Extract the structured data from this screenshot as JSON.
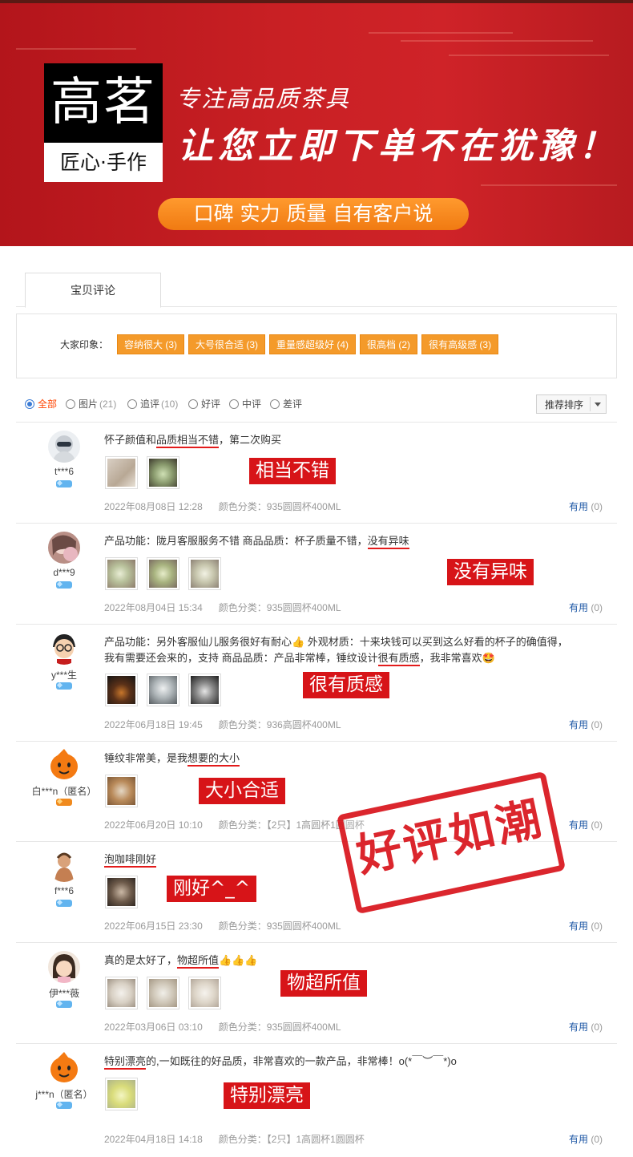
{
  "banner": {
    "logo_big": "高茗",
    "logo_small": "匠心·手作",
    "slogan1": "专注高品质茶具",
    "slogan2": "让您立即下单不在犹豫！",
    "pill": "口碑 实力 质量 自有客户说"
  },
  "tab": {
    "label": "宝贝评论"
  },
  "impressions": {
    "label": "大家印象：",
    "tags": [
      "容纳很大 (3)",
      "大号很合适 (3)",
      "重量感超级好 (4)",
      "很高档 (2)",
      "很有高级感 (3)"
    ]
  },
  "filters": [
    {
      "label": "全部",
      "count": ""
    },
    {
      "label": "图片",
      "count": "(21)"
    },
    {
      "label": "追评",
      "count": "(10)"
    },
    {
      "label": "好评",
      "count": ""
    },
    {
      "label": "中评",
      "count": ""
    },
    {
      "label": "差评",
      "count": ""
    }
  ],
  "sort": {
    "label": "推荐排序"
  },
  "useful_label": "有用",
  "useful_count": "(0)",
  "color_prefix": "颜色分类：",
  "reviews": [
    {
      "user": "t***6",
      "text_pre": "怀子颜值和",
      "text_mark": "品质相当不错",
      "text_post": "，第二次购买",
      "stamp": "相当不错",
      "date": "2022年08月08日 12:28",
      "color": "935圆圆杯400ML"
    },
    {
      "user": "d***9",
      "text_pre": "产品功能：陇月客服服务不错 商品品质：杯子质量不错，",
      "text_mark": "没有异味",
      "text_post": "",
      "stamp": "没有异味",
      "date": "2022年08月04日 15:34",
      "color": "935圆圆杯400ML"
    },
    {
      "user": "y***生",
      "text_line1": "产品功能：另外客服仙儿服务很好有耐心👍 外观材质：十来块钱可以买到这么好看的杯子的确值得，",
      "text_pre": "我有需要还会来的，支持 商品品质：产品非常棒，锤纹设计",
      "text_mark": "很有质感",
      "text_post": "，我非常喜欢🤩",
      "stamp": "很有质感",
      "date": "2022年06月18日 19:45",
      "color": "936高圆杯400ML"
    },
    {
      "user": "白***n（匿名）",
      "text_pre": "锤纹非常美，是我",
      "text_mark": "想要的大小",
      "text_post": "",
      "stamp": "大小合适",
      "date": "2022年06月20日 10:10",
      "color": "【2只】1高圆杯1圆圆杯"
    },
    {
      "user": "f***6",
      "text_pre": "",
      "text_mark": "泡咖啡刚好",
      "text_post": "",
      "stamp": "刚好^_^",
      "date": "2022年06月15日 23:30",
      "color": "935圆圆杯400ML"
    },
    {
      "user": "伊***薇",
      "text_pre": "真的是太好了，",
      "text_mark": "物超所值",
      "text_post": "👍👍👍",
      "stamp": "物超所值",
      "date": "2022年03月06日 03:10",
      "color": "935圆圆杯400ML"
    },
    {
      "user": "j***n（匿名）",
      "text_pre": "",
      "text_mark": "特别漂亮",
      "text_post": "的,一如既往的好品质，非常喜欢的一款产品，非常棒！o(*￣︶￣*)o",
      "stamp": "特别漂亮",
      "date": "2022年04月18日 14:18",
      "color": "【2只】1高圆杯1圆圆杯"
    }
  ],
  "big_stamp": "好评如潮",
  "colors": {
    "banner_red": "#c92024",
    "pill_orange": "#f28a1e",
    "tag_orange": "#f49a2a",
    "stamp_red": "#d71418",
    "link_blue": "#1d57a5"
  }
}
